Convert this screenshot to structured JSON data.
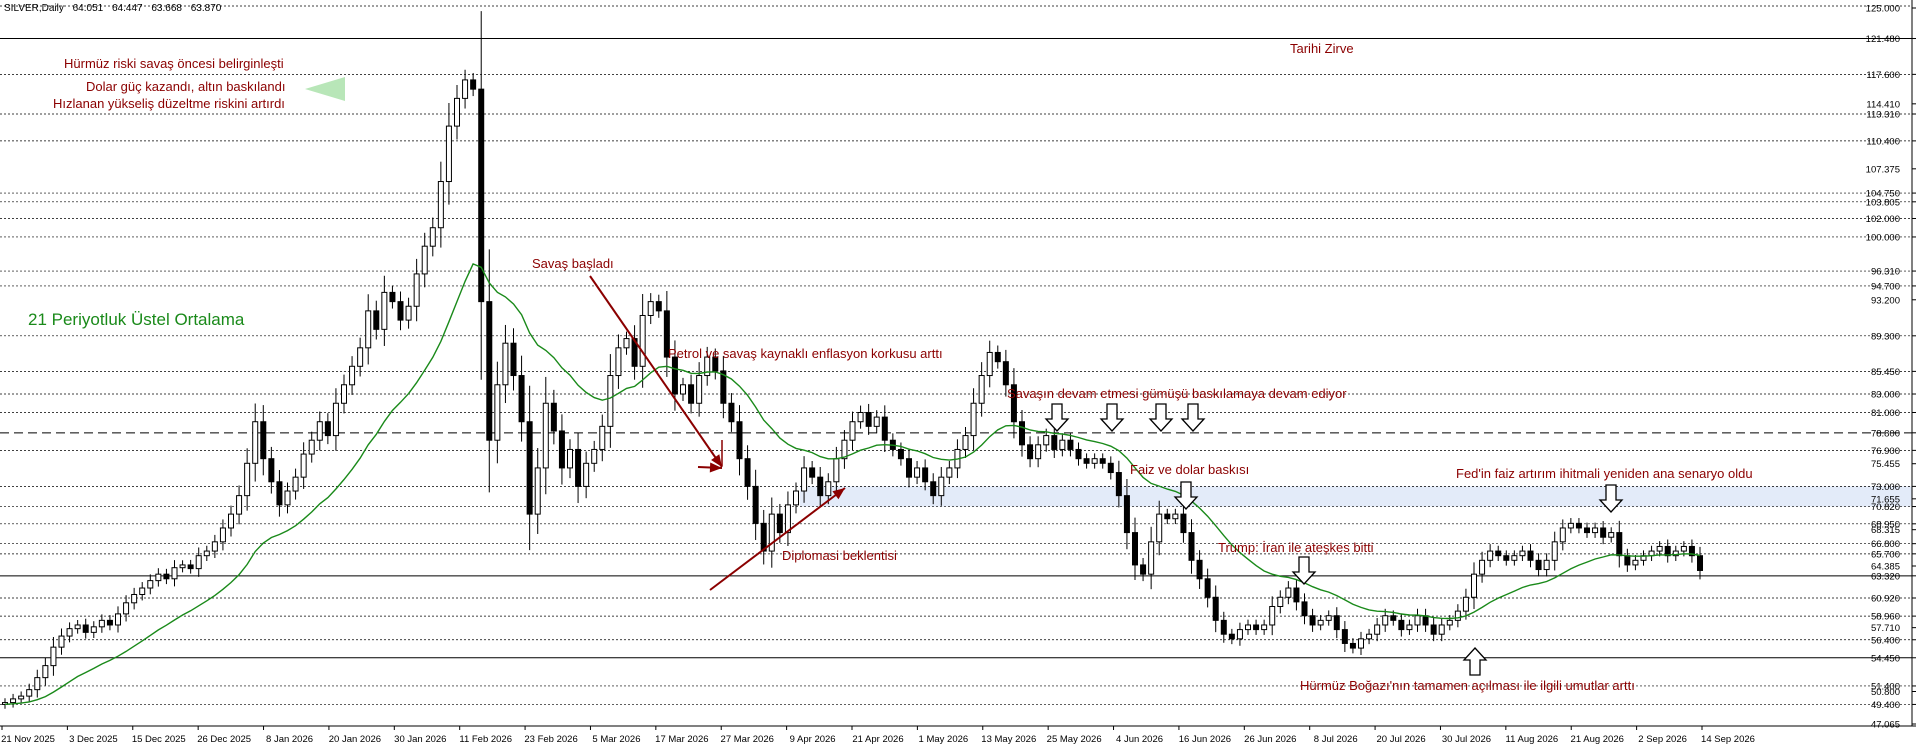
{
  "header": {
    "symbol": "SILVER,Daily",
    "open": "64.051",
    "high": "64.447",
    "low": "63.668",
    "close": "63.870"
  },
  "chart_data": {
    "type": "candlestick",
    "symbol": "SILVER,Daily",
    "price_range": [
      47.065,
      125.0
    ],
    "price_ticks": [
      "125.000",
      "121.480",
      "117.600",
      "114.410",
      "113.310",
      "110.400",
      "107.375",
      "104.750",
      "103.805",
      "102.000",
      "100.000",
      "96.310",
      "94.700",
      "93.200",
      "89.300",
      "85.450",
      "83.000",
      "81.000",
      "78.800",
      "76.900",
      "75.455",
      "73.000",
      "70.820",
      "71.655",
      "68.950",
      "68.315",
      "66.800",
      "65.700",
      "64.385",
      "63.320",
      "60.920",
      "58.960",
      "57.710",
      "56.400",
      "54.450",
      "51.400",
      "50.800",
      "49.400",
      "47.065"
    ],
    "horizontal_levels": [
      125.0,
      121.48,
      117.6,
      113.31,
      110.4,
      104.75,
      103.805,
      102.0,
      100.0,
      96.31,
      94.7,
      89.3,
      85.45,
      83.0,
      81.0,
      76.9,
      73.0,
      70.82,
      68.95,
      66.8,
      65.7,
      63.32,
      60.92,
      58.96,
      56.4,
      54.45,
      51.4,
      49.4
    ],
    "solid_levels": [
      121.48,
      63.32,
      54.45
    ],
    "dashed_level": 78.8,
    "highlight_zone": [
      70.82,
      73.0
    ],
    "date_ticks": [
      "21 Nov 2025",
      "3 Dec 2025",
      "15 Dec 2025",
      "26 Dec 2025",
      "8 Jan 2026",
      "20 Jan 2026",
      "30 Jan 2026",
      "11 Feb 2026",
      "23 Feb 2026",
      "5 Mar 2026",
      "17 Mar 2026",
      "27 Mar 2026",
      "9 Apr 2026",
      "21 Apr 2026",
      "1 May 2026",
      "13 May 2026",
      "25 May 2026",
      "4 Jun 2026",
      "16 Jun 2026",
      "26 Jun 2026",
      "8 Jul 2026",
      "20 Jul 2026",
      "30 Jul 2026",
      "11 Aug 2026",
      "21 Aug 2026",
      "2 Sep 2026",
      "14 Sep 2026"
    ],
    "closes": [
      49.6,
      50.0,
      50.3,
      51.0,
      52.3,
      53.6,
      55.6,
      56.8,
      57.6,
      58.0,
      57.2,
      57.8,
      58.5,
      58.0,
      59.2,
      60.4,
      61.3,
      62.0,
      62.8,
      63.5,
      63.0,
      64.2,
      64.5,
      64.1,
      65.5,
      66.0,
      67.0,
      68.5,
      70.0,
      72.0,
      75.5,
      80.0,
      76.0,
      73.5,
      71.0,
      72.5,
      74.0,
      76.5,
      78.0,
      80.0,
      78.5,
      82.0,
      84.0,
      86.0,
      88.0,
      92.0,
      90.0,
      94.0,
      93.0,
      91.0,
      92.5,
      96.0,
      99.0,
      101.0,
      106.0,
      112.0,
      115.0,
      117.0,
      116.0,
      93.0,
      78.0,
      84.0,
      88.5,
      85.0,
      80.0,
      70.0,
      75.0,
      82.0,
      79.0,
      75.0,
      77.0,
      73.0,
      75.5,
      77.0,
      79.5,
      85.0,
      88.0,
      89.0,
      86.0,
      91.5,
      93.0,
      92.0,
      87.0,
      83.0,
      84.0,
      82.0,
      85.0,
      87.0,
      85.5,
      82.0,
      80.0,
      76.0,
      73.0,
      69.0,
      66.0,
      70.0,
      68.0,
      71.0,
      72.5,
      75.0,
      74.0,
      72.0,
      73.5,
      76.0,
      78.0,
      80.0,
      81.0,
      79.5,
      80.5,
      78.0,
      77.0,
      76.0,
      74.0,
      75.0,
      73.5,
      72.0,
      74.0,
      75.0,
      77.0,
      78.5,
      82.0,
      85.0,
      87.5,
      86.5,
      84.0,
      80.0,
      77.5,
      76.0,
      77.5,
      78.5,
      77.0,
      78.0,
      77.0,
      76.0,
      75.5,
      76.0,
      75.5,
      74.5,
      72.0,
      68.0,
      64.5,
      63.5,
      67.0,
      70.0,
      69.5,
      70.0,
      68.0,
      65.0,
      63.0,
      61.0,
      58.5,
      57.0,
      56.5,
      57.5,
      58.0,
      57.5,
      58.0,
      60.0,
      61.0,
      62.0,
      60.5,
      59.0,
      58.0,
      58.5,
      59.0,
      57.5,
      56.0,
      55.5,
      56.5,
      57.0,
      58.0,
      59.0,
      58.5,
      57.5,
      58.0,
      59.0,
      58.0,
      57.0,
      58.0,
      58.5,
      59.5,
      61.0,
      63.5,
      65.0,
      66.0,
      65.5,
      65.0,
      65.5,
      66.0,
      65.0,
      64.0,
      65.0,
      67.0,
      68.5,
      69.0,
      68.5,
      68.0,
      68.5,
      67.5,
      68.0,
      65.5,
      64.5,
      65.0,
      65.5,
      66.0,
      66.5,
      65.5,
      66.0,
      66.5,
      65.5,
      63.9
    ],
    "ema21_start": 49.4,
    "annotations": [
      {
        "text": "Hürmüz riski savaş öncesi belirginleşti"
      },
      {
        "text": "Dolar güç kazandı, altın baskılandı"
      },
      {
        "text": "Hızlanan yükseliş düzeltme riskini artırdı"
      },
      {
        "text": "Tarihi Zirve"
      },
      {
        "text": "21 Periyotluk Üstel Ortalama"
      },
      {
        "text": "Savaş başladı"
      },
      {
        "text": "Petrol ve savaş kaynaklı enflasyon korkusu arttı"
      },
      {
        "text": "Savaşın devam etmesi gümüşü baskılamaya devam ediyor"
      },
      {
        "text": "Faiz ve dolar baskısı"
      },
      {
        "text": "Diplomasi beklentisi"
      },
      {
        "text": "Trump: İran ile ateşkes bitti"
      },
      {
        "text": "Fed'in faiz artırım ihitmali yeniden ana senaryo oldu"
      },
      {
        "text": "Hürmüz Boğazı'nın tamamen açılması ile ilgili umutlar arttı"
      }
    ],
    "colors": {
      "ema": "#1a8a1a",
      "annotation": "#8b0000",
      "zone": "#e3ebf9",
      "candle": "#000000"
    }
  }
}
